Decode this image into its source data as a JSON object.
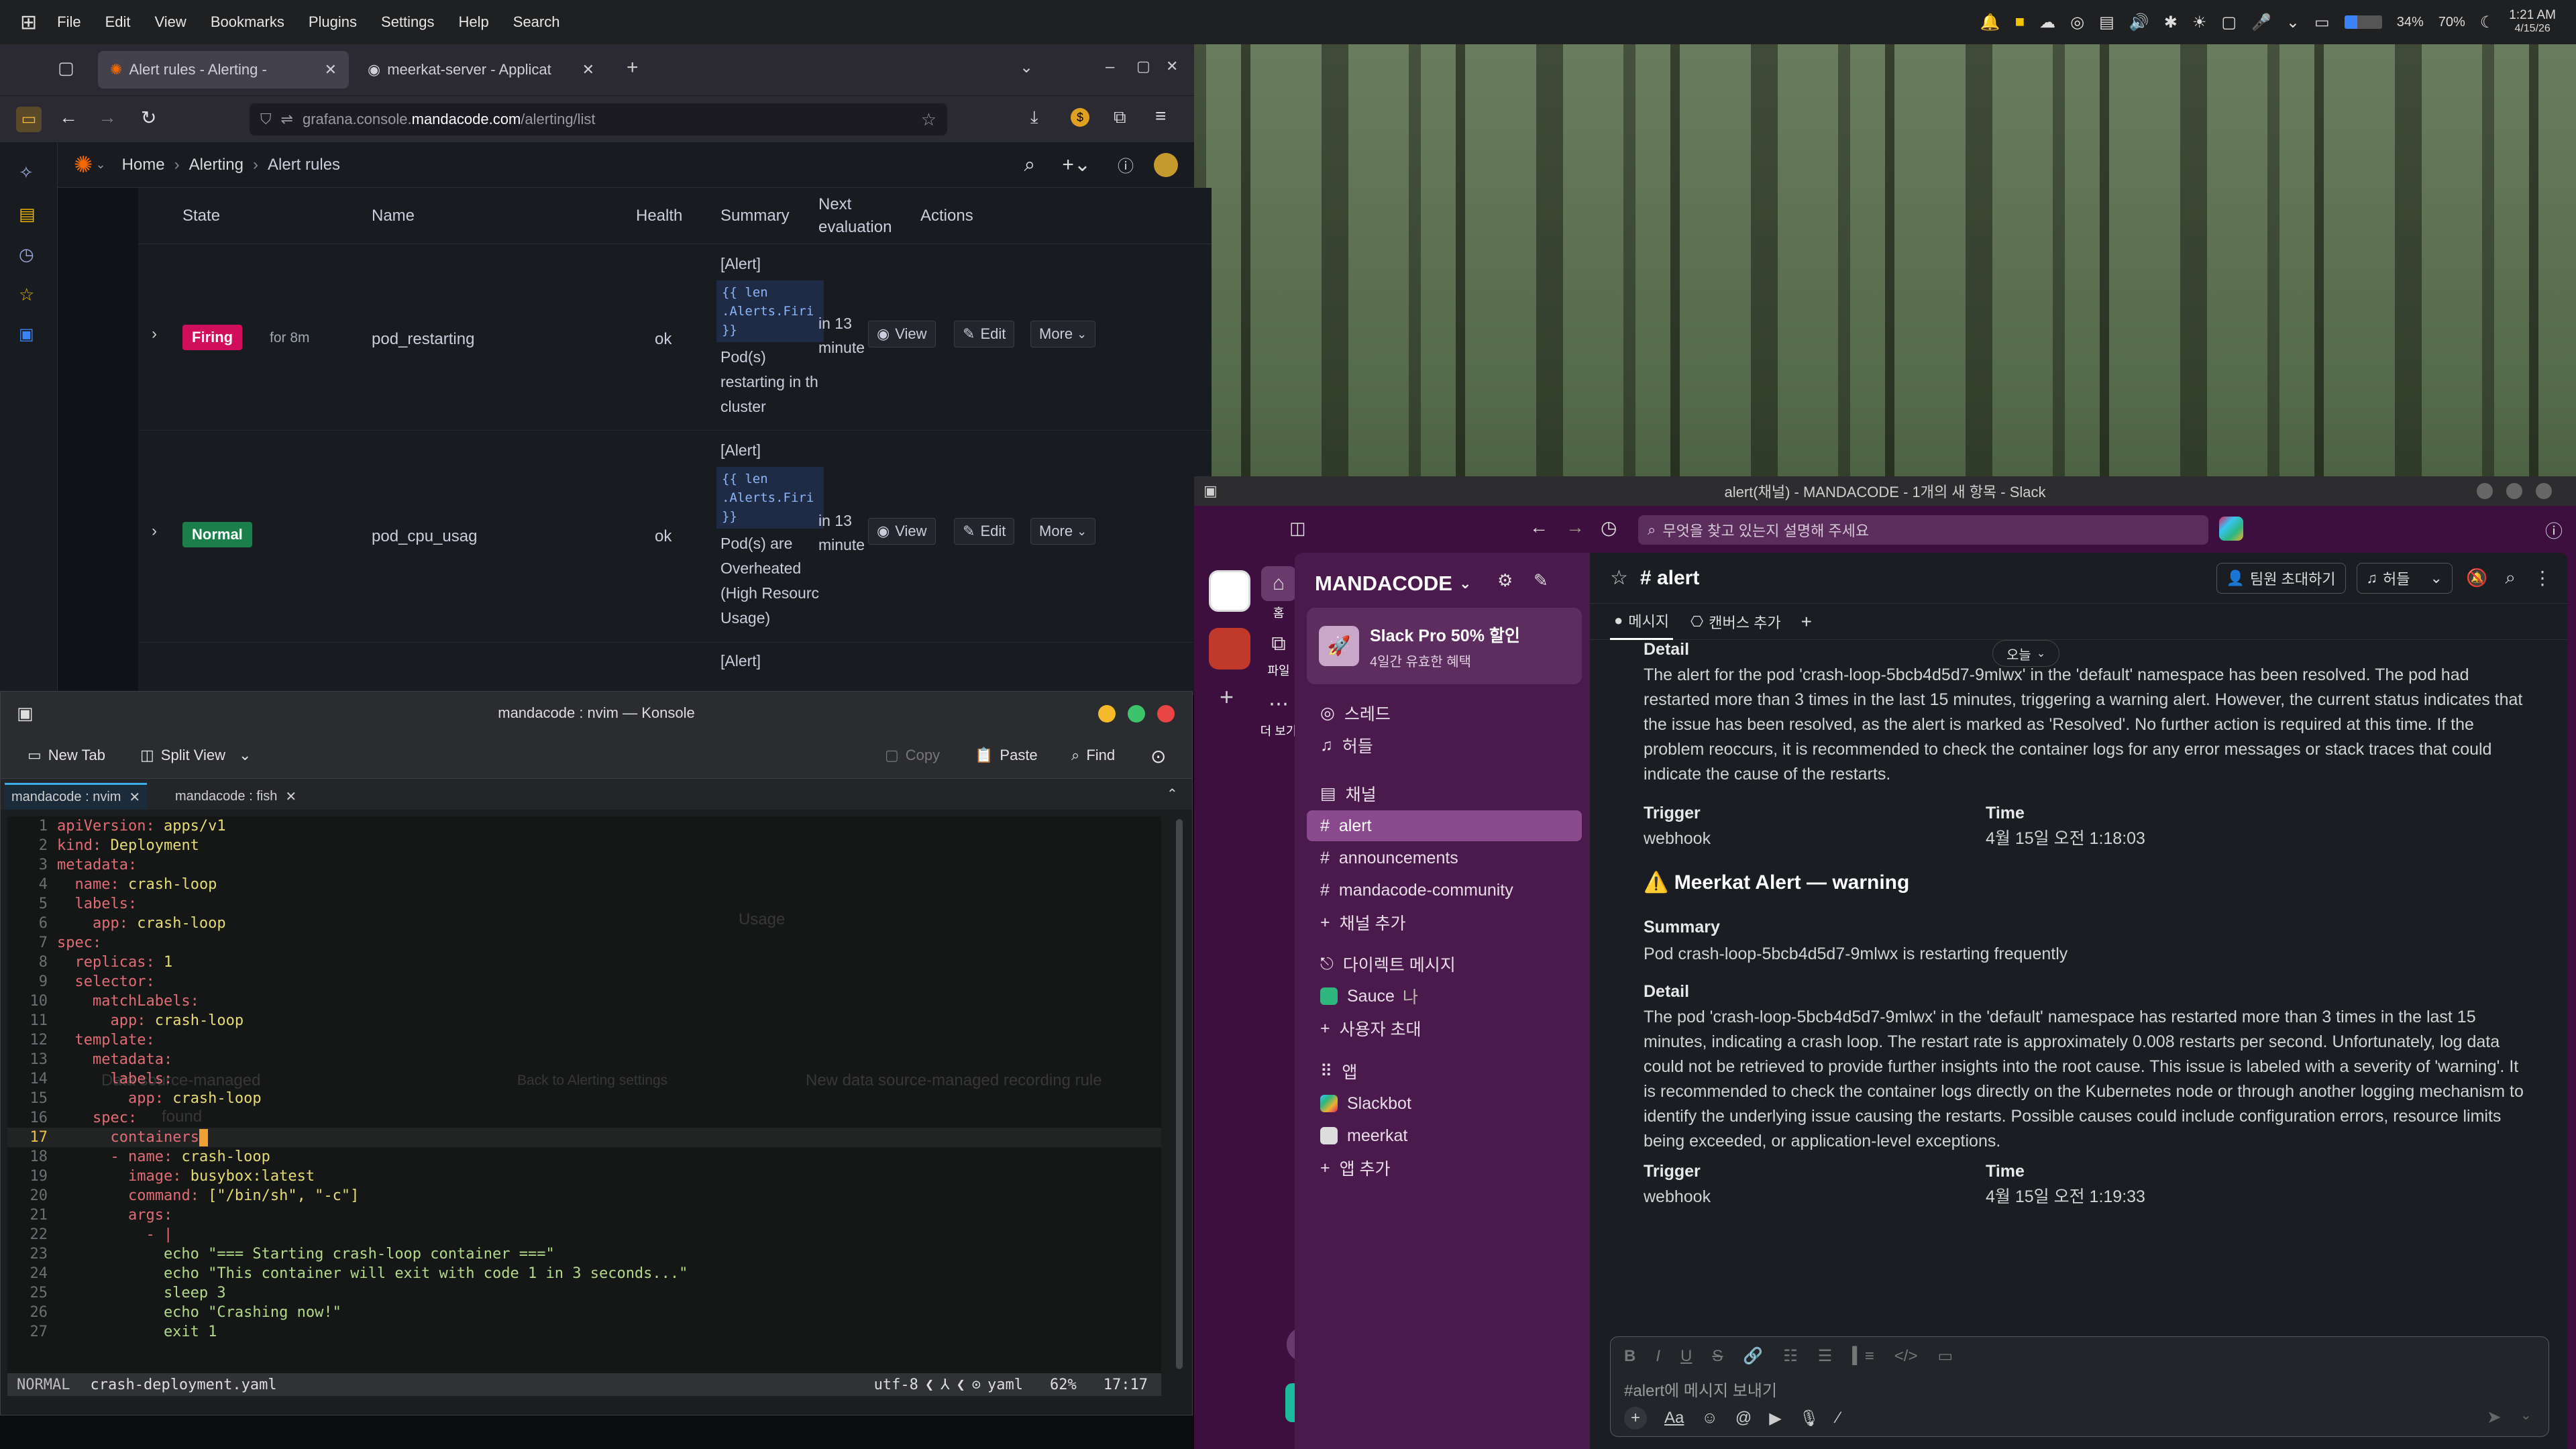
{
  "topbar": {
    "menu": [
      "File",
      "Edit",
      "View",
      "Bookmarks",
      "Plugins",
      "Settings",
      "Help",
      "Search"
    ],
    "battery1": "34%",
    "battery2": "70%",
    "time": "1:21 AM",
    "date": "4/15/26"
  },
  "browser": {
    "tabs": [
      {
        "title": "Alert rules - Alerting -"
      },
      {
        "title": "meerkat-server - Applicat"
      }
    ],
    "url": {
      "prefix": "grafana.console.",
      "domain": "mandacode.com",
      "path": "/alerting/list"
    },
    "breadcrumb": [
      "Home",
      "Alerting",
      "Alert rules"
    ],
    "table": {
      "headers": [
        "State",
        "Name",
        "Health",
        "Summary",
        "Next\nevaluation",
        "Actions"
      ],
      "rows": [
        {
          "state": "Firing",
          "duration": "for 8m",
          "name": "pod_restarting",
          "health": "ok",
          "summary_prefix": "[Alert]",
          "summary_code": "{{ len\n.Alerts.Firi\n}}",
          "summary_text": "Pod(s)\nrestarting in th\ncluster",
          "next": "in 13\nminute"
        },
        {
          "state": "Normal",
          "duration": "",
          "name": "pod_cpu_usag",
          "health": "ok",
          "summary_prefix": "[Alert]",
          "summary_code": "{{ len\n.Alerts.Firi\n}}",
          "summary_text": "Pod(s) are\nOverheated\n(High Resourc\nUsage)",
          "next": "in 13\nminute"
        }
      ],
      "partial_row": {
        "summary_prefix": "[Alert]"
      },
      "actions": {
        "view": "View",
        "edit": "Edit",
        "more": "More"
      }
    },
    "faded": {
      "label": "Data source-managed",
      "found": "found",
      "back": "Back to Alerting settings",
      "new_rule": "New data source-managed recording rule",
      "usage": "Usage"
    }
  },
  "konsole": {
    "title": "mandacode : nvim — Konsole",
    "toolbar": {
      "new_tab": "New Tab",
      "split_view": "Split View",
      "copy": "Copy",
      "paste": "Paste",
      "find": "Find"
    },
    "tabs": [
      "mandacode : nvim",
      "mandacode : fish"
    ],
    "lines": [
      {
        "n": "1",
        "t": [
          [
            "k",
            "apiVersion:"
          ],
          [
            "v",
            " apps/v1"
          ]
        ]
      },
      {
        "n": "2",
        "t": [
          [
            "k",
            "kind:"
          ],
          [
            "v",
            " Deployment"
          ]
        ]
      },
      {
        "n": "3",
        "t": [
          [
            "k",
            "metadata:"
          ]
        ]
      },
      {
        "n": "4",
        "t": [
          [
            "p",
            "  "
          ],
          [
            "k",
            "name:"
          ],
          [
            "v",
            " crash-loop"
          ]
        ]
      },
      {
        "n": "5",
        "t": [
          [
            "p",
            "  "
          ],
          [
            "k",
            "labels:"
          ]
        ]
      },
      {
        "n": "6",
        "t": [
          [
            "p",
            "    "
          ],
          [
            "k",
            "app:"
          ],
          [
            "v",
            " crash-loop"
          ]
        ]
      },
      {
        "n": "7",
        "t": [
          [
            "k",
            "spec:"
          ]
        ]
      },
      {
        "n": "8",
        "t": [
          [
            "p",
            "  "
          ],
          [
            "k",
            "replicas:"
          ],
          [
            "v",
            " 1"
          ]
        ]
      },
      {
        "n": "9",
        "t": [
          [
            "p",
            "  "
          ],
          [
            "k",
            "selector:"
          ]
        ]
      },
      {
        "n": "10",
        "t": [
          [
            "p",
            "    "
          ],
          [
            "k",
            "matchLabels:"
          ]
        ]
      },
      {
        "n": "11",
        "t": [
          [
            "p",
            "      "
          ],
          [
            "k",
            "app:"
          ],
          [
            "v",
            " crash-loop"
          ]
        ]
      },
      {
        "n": "12",
        "t": [
          [
            "p",
            "  "
          ],
          [
            "k",
            "template:"
          ]
        ]
      },
      {
        "n": "13",
        "t": [
          [
            "p",
            "    "
          ],
          [
            "k",
            "metadata:"
          ]
        ]
      },
      {
        "n": "14",
        "t": [
          [
            "p",
            "      "
          ],
          [
            "k",
            "labels:"
          ]
        ]
      },
      {
        "n": "15",
        "t": [
          [
            "p",
            "        "
          ],
          [
            "k",
            "app:"
          ],
          [
            "v",
            " crash-loop"
          ]
        ]
      },
      {
        "n": "16",
        "t": [
          [
            "p",
            "    "
          ],
          [
            "k",
            "spec:"
          ]
        ]
      },
      {
        "n": "17",
        "t": [
          [
            "p",
            "      "
          ],
          [
            "k",
            "containers"
          ],
          [
            "p",
            ":"
          ]
        ]
      },
      {
        "n": "18",
        "t": [
          [
            "p",
            "      "
          ],
          [
            "k",
            "- "
          ],
          [
            "k",
            "name:"
          ],
          [
            "v",
            " crash-loop"
          ]
        ]
      },
      {
        "n": "19",
        "t": [
          [
            "p",
            "        "
          ],
          [
            "k",
            "image:"
          ],
          [
            "v",
            " busybox:latest"
          ]
        ]
      },
      {
        "n": "20",
        "t": [
          [
            "p",
            "        "
          ],
          [
            "k",
            "command:"
          ],
          [
            "v",
            " [\"/bin/sh\", \"-c\"]"
          ]
        ]
      },
      {
        "n": "21",
        "t": [
          [
            "p",
            "        "
          ],
          [
            "k",
            "args:"
          ]
        ]
      },
      {
        "n": "22",
        "t": [
          [
            "p",
            "          "
          ],
          [
            "k",
            "- |"
          ]
        ]
      },
      {
        "n": "23",
        "t": [
          [
            "s",
            "            echo \"=== Starting crash-loop container ===\""
          ]
        ]
      },
      {
        "n": "24",
        "t": [
          [
            "s",
            "            echo \"This container will exit with code 1 in 3 seconds...\""
          ]
        ]
      },
      {
        "n": "25",
        "t": [
          [
            "s",
            "            sleep 3"
          ]
        ]
      },
      {
        "n": "26",
        "t": [
          [
            "s",
            "            echo \"Crashing now!\""
          ]
        ]
      },
      {
        "n": "27",
        "t": [
          [
            "s",
            "            exit 1"
          ]
        ]
      }
    ],
    "status": {
      "mode": "NORMAL",
      "file": "crash-deployment.yaml",
      "enc": "utf-8",
      "ft": "yaml",
      "pct": "62%",
      "pos": "17:17"
    }
  },
  "slack": {
    "window_title": "alert(채널) - MANDACODE - 1개의 새 항목 - Slack",
    "search_placeholder": "무엇을 찾고 있는지 설명해 주세요",
    "rail": {
      "home": "홈",
      "files": "파일",
      "more": "더 보기"
    },
    "workspace": "MANDACODE",
    "promo": {
      "title": "Slack Pro 50% 할인",
      "sub": "4일간 유효한 혜택"
    },
    "nav": {
      "threads": "스레드",
      "huddles": "허들",
      "channels_h": "채널",
      "dm_h": "다이렉트 메시지",
      "apps_h": "앱"
    },
    "channels": [
      "alert",
      "announcements",
      "mandacode-community"
    ],
    "add_channel": "채널 추가",
    "dm": {
      "name": "Sauce",
      "me": "나"
    },
    "invite": "사용자 초대",
    "apps": [
      "Slackbot",
      "meerkat"
    ],
    "add_app": "앱 추가",
    "channel_name": "alert",
    "invite_btn": "팀원 초대하기",
    "huddle_btn": "허들",
    "tabs": {
      "messages": "메시지",
      "canvas": "캔버스 추가"
    },
    "date_pill": "오늘",
    "msg1": {
      "detail_label": "Detail",
      "detail": "The alert for the pod 'crash-loop-5bcb4d5d7-9mlwx' in the 'default' namespace has been resolved. The pod had restarted more than 3 times in the last 15 minutes, triggering a warning alert. However, the current status indicates that the issue has been resolved, as the alert is marked as 'Resolved'. No further action is required at this time. If the problem reoccurs, it is recommended to check the container logs for any error messages or stack traces that could indicate the cause of the restarts.",
      "trigger_label": "Trigger",
      "trigger": "webhook",
      "time_label": "Time",
      "time": "4월 15일 오전 1:18:03"
    },
    "msg2": {
      "heading": "⚠️ Meerkat Alert — warning",
      "summary_label": "Summary",
      "summary": "Pod crash-loop-5bcb4d5d7-9mlwx is restarting frequently",
      "detail_label": "Detail",
      "detail": "The pod 'crash-loop-5bcb4d5d7-9mlwx' in the 'default' namespace has restarted more than 3 times in the last 15 minutes, indicating a crash loop. The restart rate is approximately 0.008 restarts per second. Unfortunately, log data could not be retrieved to provide further insights into the root cause. This issue is labeled with a severity of 'warning'. It is recommended to check the container logs directly on the Kubernetes node or through another logging mechanism to identify the underlying issue causing the restarts. Possible causes could include configuration errors, resource limits being exceeded, or application-level exceptions.",
      "trigger_label": "Trigger",
      "trigger": "webhook",
      "time_label": "Time",
      "time": "4월 15일 오전 1:19:33"
    },
    "composer_placeholder": "#alert에 메시지 보내기",
    "fmt": {
      "aa": "Aa"
    }
  }
}
